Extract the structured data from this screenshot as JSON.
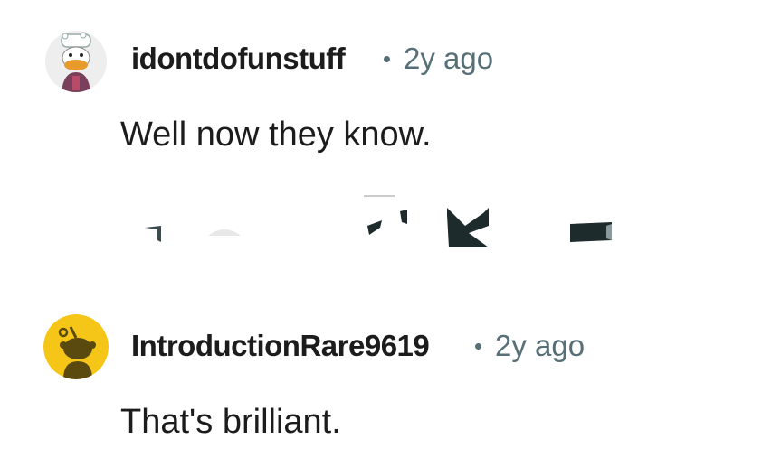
{
  "comments": [
    {
      "username": "idontdofunstuff",
      "timestamp": "2y ago",
      "text": "Well now they know.",
      "avatar_icon": "duck-avatar-icon"
    },
    {
      "username": "IntroductionRare9619",
      "timestamp": "2y ago",
      "text": "That's brilliant.",
      "avatar_icon": "snoo-avatar-icon",
      "avatar_color": "#f5c518"
    }
  ],
  "actions": {
    "upvote_icon": "upvote-icon",
    "downvote_icon": "downvote-icon",
    "reply_icon": "reply-icon",
    "award_icon": "award-icon",
    "share_icon": "share-icon"
  }
}
